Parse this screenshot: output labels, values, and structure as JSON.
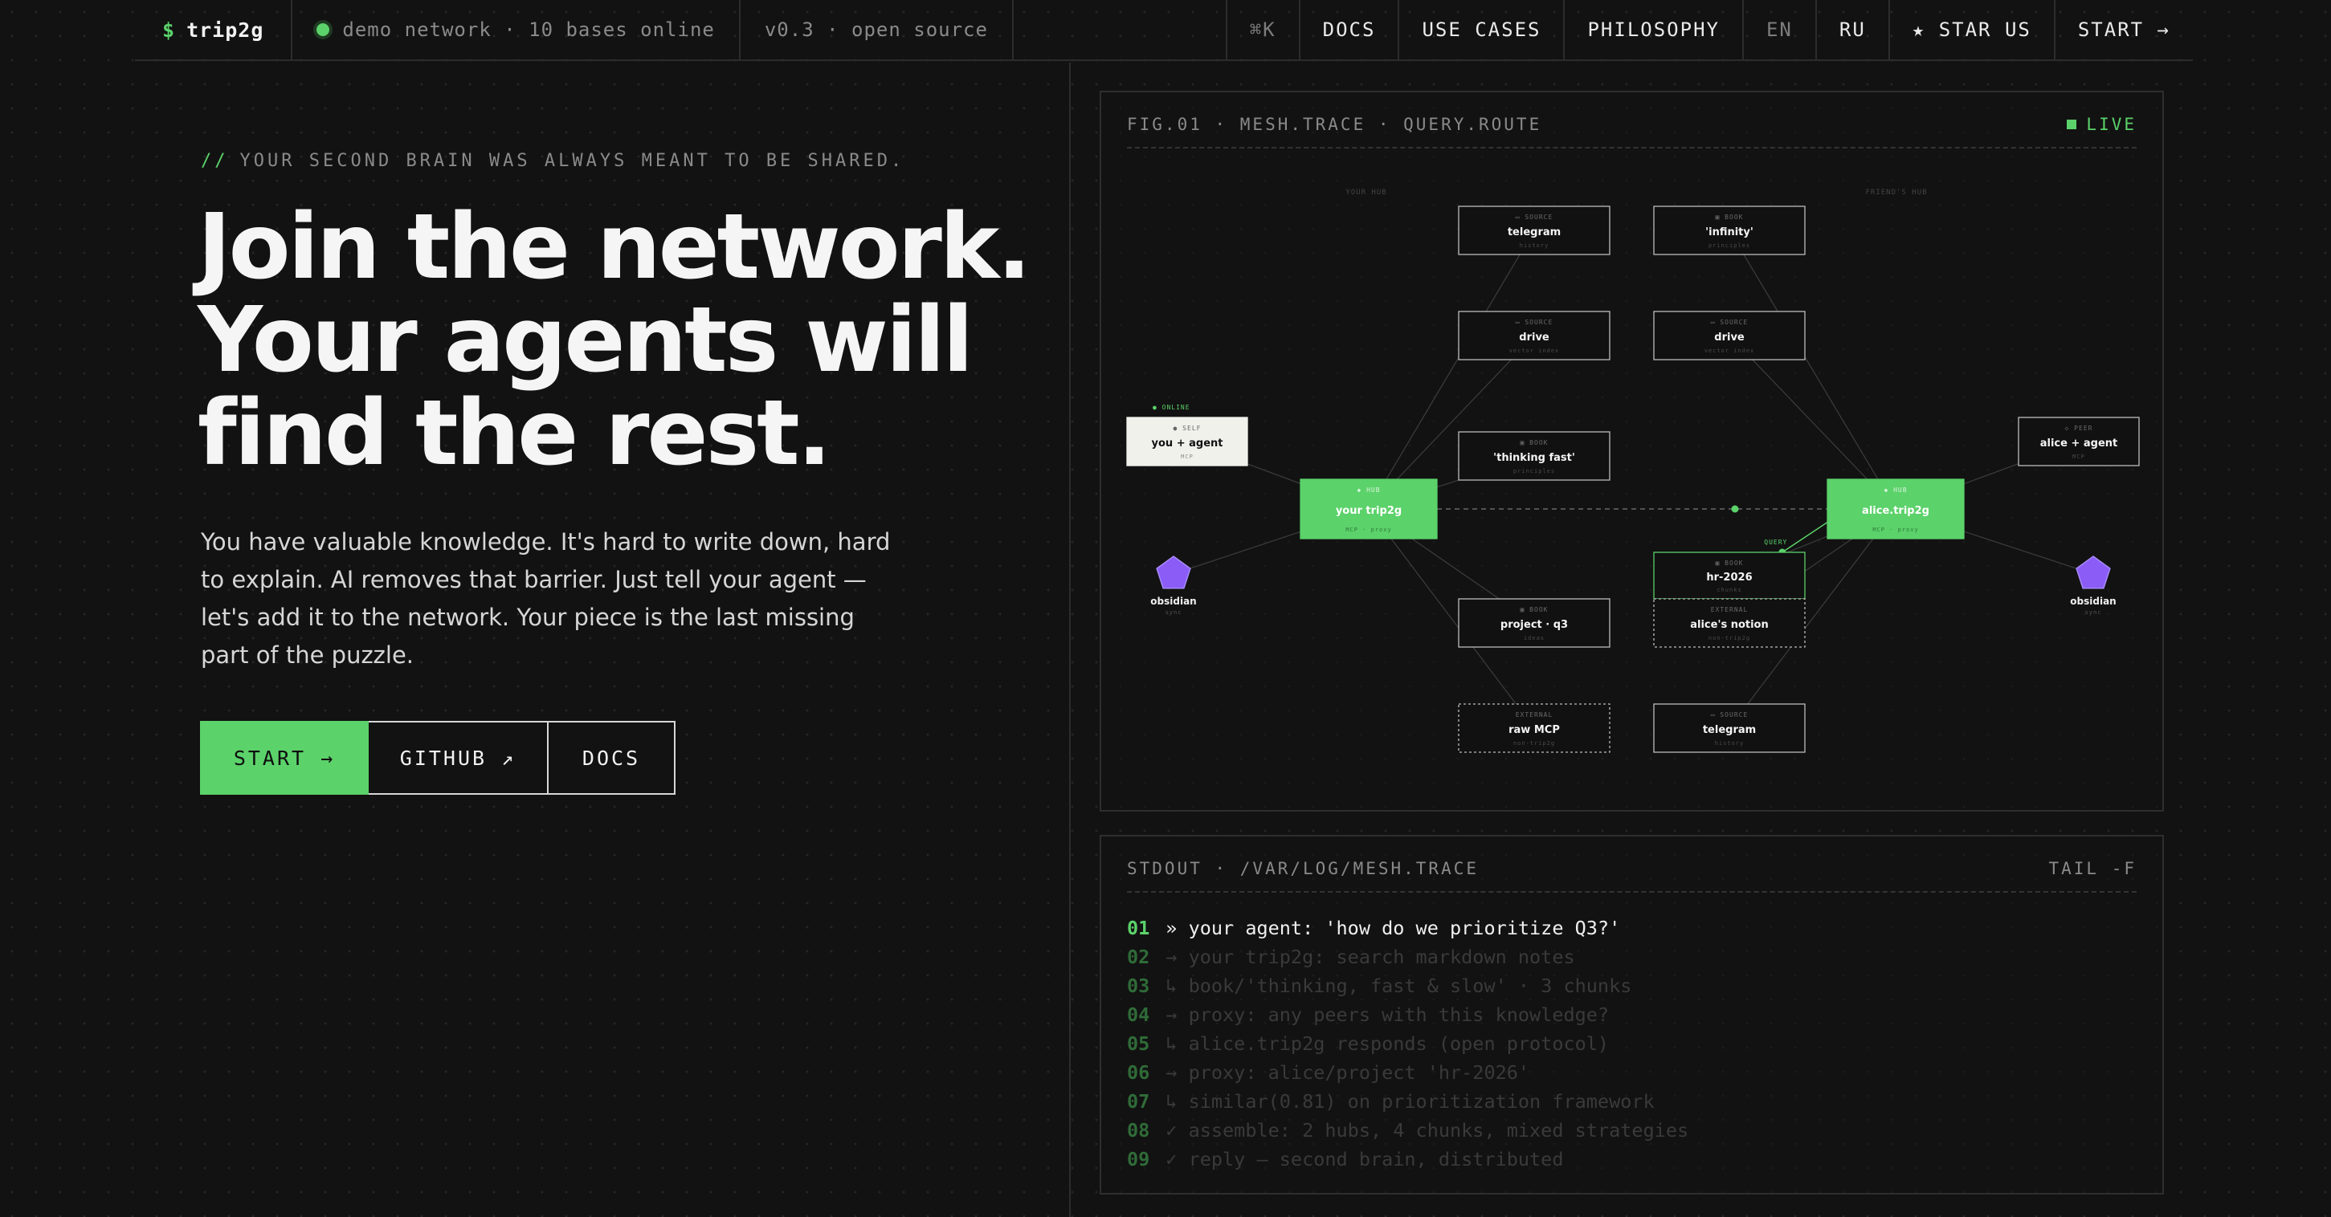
{
  "nav": {
    "brand_symbol": "$",
    "brand_name": "trip2g",
    "status_text": "demo network · 10 bases online",
    "version_text": "v0.3 · open source",
    "shortcut": "⌘K",
    "links": [
      "DOCS",
      "USE CASES",
      "PHILOSOPHY"
    ],
    "lang_en": "EN",
    "lang_ru": "RU",
    "star": "★ STAR US",
    "start": "START →"
  },
  "hero": {
    "kicker_prefix": "//",
    "kicker": "YOUR SECOND BRAIN WAS ALWAYS MEANT TO BE SHARED.",
    "headline": [
      "Join the network.",
      "Your agents will",
      "find the rest."
    ],
    "lede": "You have valuable knowledge. It's hard to write down, hard to explain. AI removes that barrier. Just tell your agent — let's add it to the network. Your piece is the last missing part of the puzzle.",
    "cta_start": "START →",
    "cta_github": "GITHUB ↗",
    "cta_docs": "DOCS"
  },
  "figure": {
    "title": "FIG.01 · MESH.TRACE · QUERY.ROUTE",
    "live": "LIVE",
    "zone_left": "YOUR HUB",
    "zone_right": "FRIEND'S HUB",
    "online_tag": "● ONLINE",
    "query_tag": "QUERY",
    "nodes": [
      {
        "id": "self",
        "tag": "● SELF",
        "label": "you + agent",
        "sub": "MCP",
        "style": "self"
      },
      {
        "id": "hubA",
        "tag": "◆ HUB",
        "label": "your trip2g",
        "sub": "MCP · proxy",
        "style": "hub"
      },
      {
        "id": "hubB",
        "tag": "◆ HUB",
        "label": "alice.trip2g",
        "sub": "MCP · proxy",
        "style": "hub"
      },
      {
        "id": "peer",
        "tag": "◇ PEER",
        "label": "alice + agent",
        "sub": "MCP",
        "style": "plain"
      },
      {
        "id": "tg1",
        "tag": "▭ SOURCE",
        "label": "telegram",
        "sub": "history",
        "style": "plain"
      },
      {
        "id": "inf",
        "tag": "▣ BOOK",
        "label": "'infinity'",
        "sub": "principles",
        "style": "plain"
      },
      {
        "id": "dr1",
        "tag": "▭ SOURCE",
        "label": "drive",
        "sub": "vector index",
        "style": "plain"
      },
      {
        "id": "dr2",
        "tag": "▭ SOURCE",
        "label": "drive",
        "sub": "vector index",
        "style": "plain"
      },
      {
        "id": "tf",
        "tag": "▣ BOOK",
        "label": "'thinking fast'",
        "sub": "principles",
        "style": "plain"
      },
      {
        "id": "hr",
        "tag": "▣ BOOK",
        "label": "hr-2026",
        "sub": "chunks",
        "style": "active"
      },
      {
        "id": "an",
        "tag": "EXTERNAL",
        "label": "alice's notion",
        "sub": "non-trip2g",
        "style": "dashed"
      },
      {
        "id": "pq",
        "tag": "▣ BOOK",
        "label": "project · q3",
        "sub": "ideas",
        "style": "plain"
      },
      {
        "id": "raw",
        "tag": "EXTERNAL",
        "label": "raw MCP",
        "sub": "non-trip2g",
        "style": "dashed"
      },
      {
        "id": "tg2",
        "tag": "▭ SOURCE",
        "label": "telegram",
        "sub": "history",
        "style": "plain"
      },
      {
        "id": "obsA",
        "label": "obsidian",
        "sub": "sync",
        "style": "gem"
      },
      {
        "id": "obsB",
        "label": "obsidian",
        "sub": "sync",
        "style": "gem"
      }
    ]
  },
  "stdout": {
    "title": "STDOUT · /VAR/LOG/MESH.TRACE",
    "tail": "TAIL -F",
    "lines": [
      {
        "n": "01",
        "text": "» your agent: 'how do we prioritize Q3?'",
        "active": true
      },
      {
        "n": "02",
        "text": "→ your trip2g: search markdown notes",
        "active": false
      },
      {
        "n": "03",
        "text": "↳ book/'thinking, fast & slow' · 3 chunks",
        "active": false
      },
      {
        "n": "04",
        "text": "→ proxy: any peers with this knowledge?",
        "active": false
      },
      {
        "n": "05",
        "text": "↳ alice.trip2g responds (open protocol)",
        "active": false
      },
      {
        "n": "06",
        "text": "→ proxy: alice/project 'hr-2026'",
        "active": false
      },
      {
        "n": "07",
        "text": "↳ similar(0.81) on prioritization framework",
        "active": false
      },
      {
        "n": "08",
        "text": "✓ assemble: 2 hubs, 4 chunks, mixed strategies",
        "active": false
      },
      {
        "n": "09",
        "text": "✓ reply — second brain, distributed",
        "active": false
      }
    ]
  },
  "colors": {
    "accent": "#5bd26a",
    "background": "#121212",
    "gem": "#8b5cf6"
  }
}
